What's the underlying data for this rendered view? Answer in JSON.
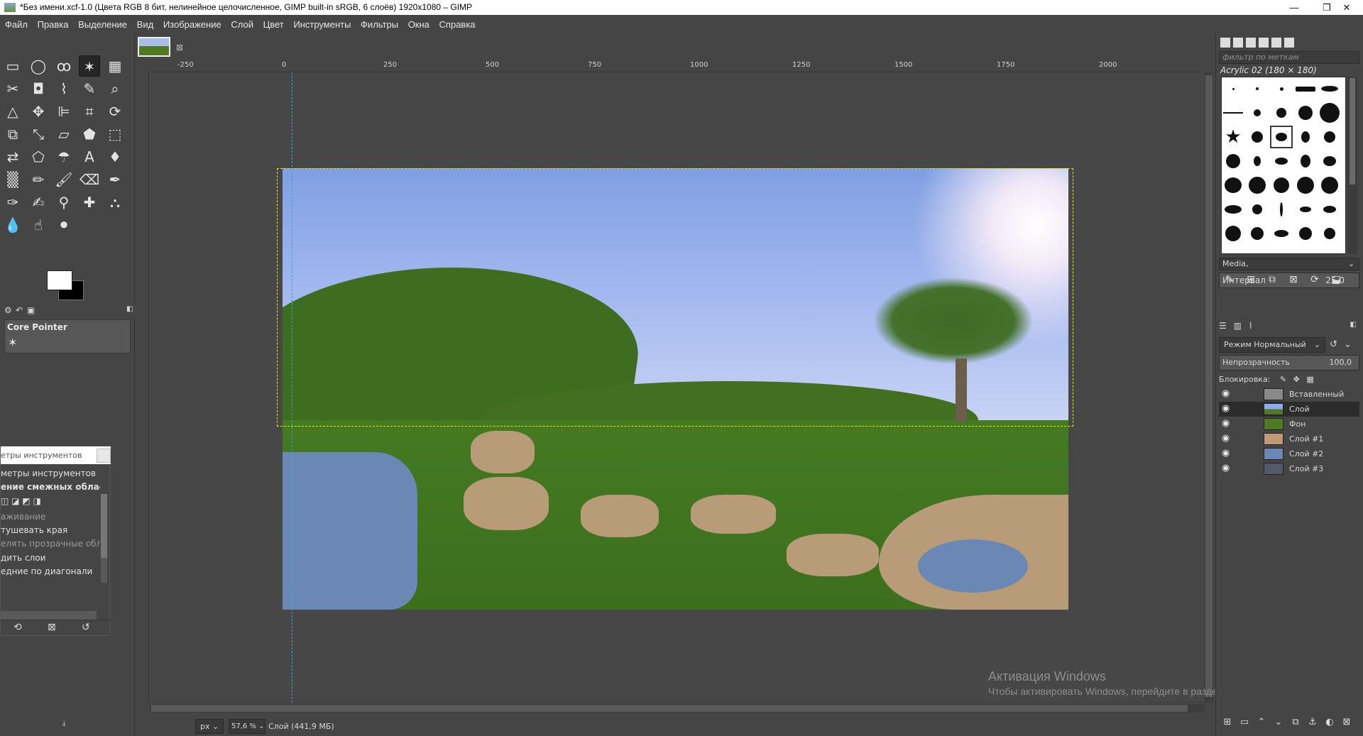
{
  "window": {
    "title": "*Без имени.xcf-1.0 (Цвета RGB 8 бит, нелинейное целочисленное, GIMP built-in sRGB, 6 слоёв) 1920x1080 – GIMP",
    "minimize": "—",
    "maximize": "❐",
    "close": "✕"
  },
  "menu": [
    "Файл",
    "Правка",
    "Выделение",
    "Вид",
    "Изображение",
    "Слой",
    "Цвет",
    "Инструменты",
    "Фильтры",
    "Окна",
    "Справка"
  ],
  "tab": {
    "close": "⊠"
  },
  "ruler": {
    "h": [
      "-250",
      "0",
      "250",
      "500",
      "750",
      "1000",
      "1250",
      "1500",
      "1750",
      "2000"
    ]
  },
  "toolbox": {
    "device_status": "Core Pointer",
    "options_window_title": "етры инструментов",
    "options": {
      "header": "метры инструментов",
      "tool_title": "ение смежных областе",
      "antialias": "аживание",
      "feather": "тушевать края",
      "select_transparent": "елять прозрачные обл",
      "sample_merged": "дить слои",
      "diagonal": "едние по диагонали"
    }
  },
  "status": {
    "unit": "px",
    "zoom": "57,6 %",
    "text": "Слой (441,9 МБ)"
  },
  "watermark": {
    "line1": "Активация Windows",
    "line2": "Чтобы активировать Windows, перейдите в раздел \"Параметры\"."
  },
  "brushes": {
    "filter_placeholder": "фильтр по меткам",
    "current": "Acrylic 02 (180 × 180)",
    "media_tag": "Media,",
    "spacing_label": "Интервал",
    "spacing_value": "25,0"
  },
  "layers": {
    "mode_label": "Режим",
    "mode_value": "Нормальный",
    "opacity_label": "Непрозрачность",
    "opacity_value": "100,0",
    "lock_label": "Блокировка:",
    "items": [
      {
        "name": "Вставленный",
        "thumb": "#8a8a8a"
      },
      {
        "name": "Слой",
        "thumb": "#6c8fcf"
      },
      {
        "name": "Фон",
        "thumb": "#4f7a23"
      },
      {
        "name": "Слой #1",
        "thumb": "#c09a74"
      },
      {
        "name": "Слой #2",
        "thumb": "#6b87b4"
      },
      {
        "name": "Слой #3",
        "thumb": "#555a6a"
      }
    ]
  },
  "colors": {
    "accent_guide": "#3aa3c9",
    "selection": "#e6e600",
    "fg": "#ffffff",
    "bg": "#000000"
  }
}
